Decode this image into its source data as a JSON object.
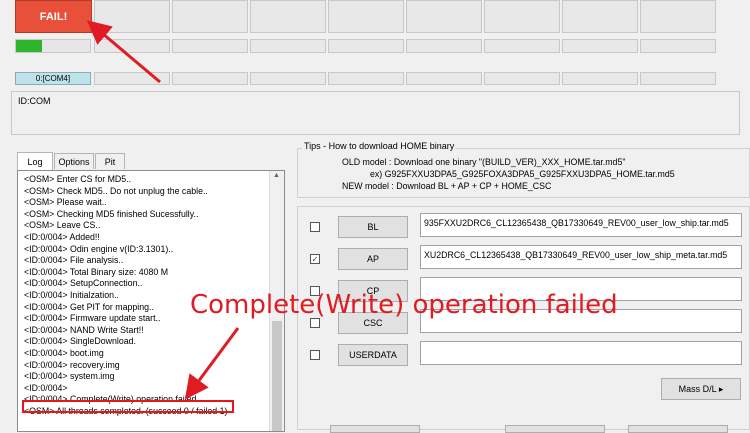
{
  "status": {
    "fail_label": "FAIL!",
    "progress_fraction": 0.35,
    "com_label": "0:[COM4]",
    "id_com_label": "ID:COM"
  },
  "tabs": [
    {
      "label": "Log"
    },
    {
      "label": "Options"
    },
    {
      "label": "Pit"
    }
  ],
  "log_lines": [
    "<OSM> Enter CS for MD5..",
    "<OSM> Check MD5.. Do not unplug the cable..",
    "<OSM> Please wait..",
    "<OSM> Checking MD5 finished Sucessfully..",
    "<OSM> Leave CS..",
    "<ID:0/004> Added!!",
    "<ID:0/004> Odin engine v(ID:3.1301)..",
    "<ID:0/004> File analysis..",
    "<ID:0/004> Total Binary size: 4080 M",
    "<ID:0/004> SetupConnection..",
    "<ID:0/004> Initialzation..",
    "<ID:0/004> Get PIT for mapping..",
    "<ID:0/004> Firmware update start..",
    "<ID:0/004> NAND Write Start!!",
    "<ID:0/004> SingleDownload.",
    "<ID:0/004> boot.img",
    "<ID:0/004> recovery.img",
    "<ID:0/004> system.img",
    "<ID:0/004>",
    "<ID:0/004> Complete(Write) operation failed.",
    "<OSM> All threads completed. (succeed 0 / failed 1)"
  ],
  "tips": {
    "title": "Tips - How to download HOME binary",
    "old_model": "OLD model  : Download one binary    \"(BUILD_VER)_XXX_HOME.tar.md5\"",
    "old_example": "ex) G925FXXU3DPA5_G925FOXA3DPA5_G925FXXU3DPA5_HOME.tar.md5",
    "new_model": "NEW model : Download BL + AP + CP + HOME_CSC"
  },
  "files": [
    {
      "label": "BL",
      "checked": "",
      "path": "935FXXU2DRC6_CL12365438_QB17330649_REV00_user_low_ship.tar.md5"
    },
    {
      "label": "AP",
      "checked": "✓",
      "path": "XU2DRC6_CL12365438_QB17330649_REV00_user_low_ship_meta.tar.md5"
    },
    {
      "label": "CP",
      "checked": "",
      "path": ""
    },
    {
      "label": "CSC",
      "checked": "",
      "path": ""
    },
    {
      "label": "USERDATA",
      "checked": "",
      "path": ""
    }
  ],
  "mass_dl_label": "Mass D/L ▸",
  "overlay_text": "Complete(Write) operation failed",
  "colors": {
    "fail": "#e8503a",
    "progress": "#2db52d",
    "annotation": "#e01b24"
  }
}
